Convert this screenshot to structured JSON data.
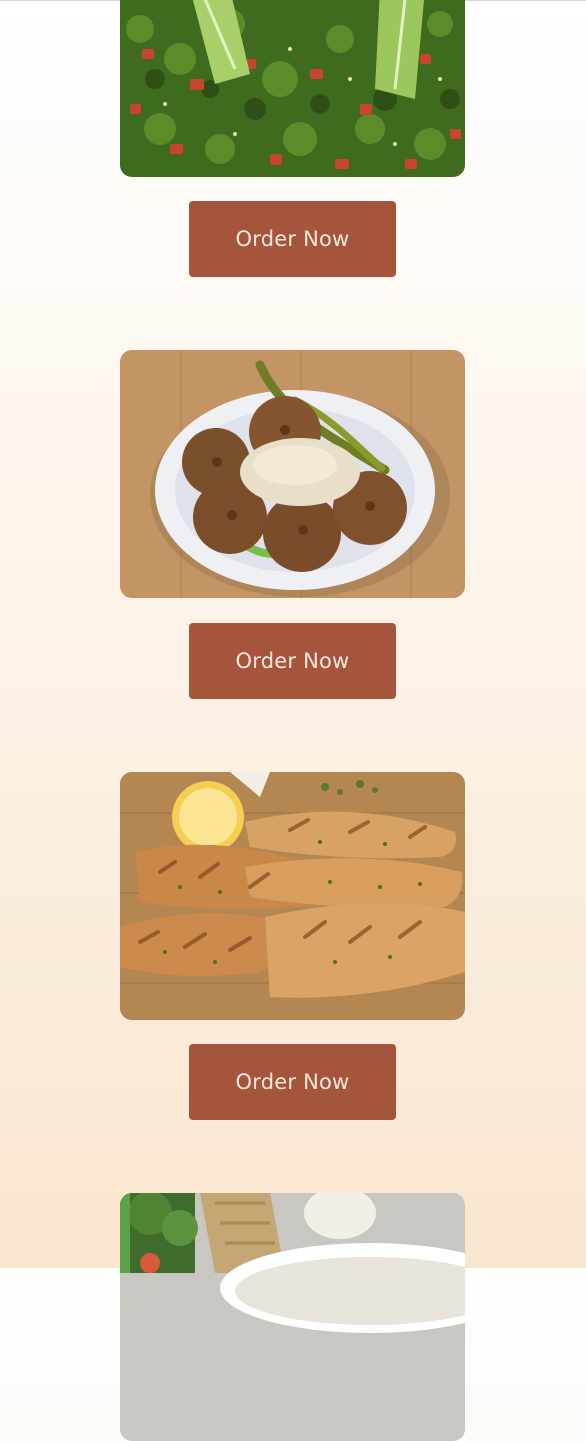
{
  "menu": {
    "items": [
      {
        "dish": "tabbouleh",
        "image_icon": "tabbouleh-image",
        "button_label": "Order Now"
      },
      {
        "dish": "falafel",
        "image_icon": "falafel-image",
        "button_label": "Order Now"
      },
      {
        "dish": "grilled-chicken",
        "image_icon": "grilled-chicken-image",
        "button_label": "Order Now"
      },
      {
        "dish": "soup",
        "image_icon": "soup-image"
      }
    ]
  },
  "colors": {
    "button_bg": "#a4553c",
    "button_text": "#fbe9da",
    "background_top": "#ffffff",
    "background_bottom": "#f9e6cf"
  }
}
